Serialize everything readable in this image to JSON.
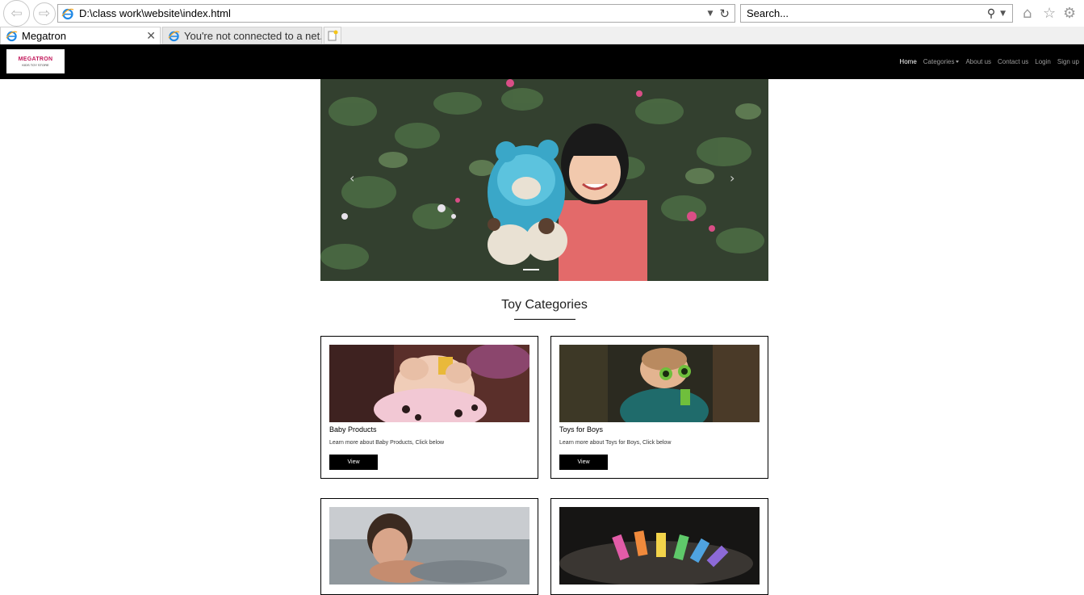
{
  "browser": {
    "url": "D:\\class work\\website\\index.html",
    "search_placeholder": "Search...",
    "tabs": [
      {
        "label": "Megatron"
      },
      {
        "label": "You're not connected to a net..."
      }
    ]
  },
  "site": {
    "logo": {
      "main": "MEGATRON",
      "sub": "KIDS TOY STORE"
    },
    "nav": [
      {
        "label": "Home"
      },
      {
        "label": "Categories"
      },
      {
        "label": "About us"
      },
      {
        "label": "Contact us"
      },
      {
        "label": "Login"
      },
      {
        "label": "Sign up"
      }
    ],
    "section_title": "Toy Categories",
    "cards": [
      {
        "title": "Baby Products",
        "text": "Learn more about Baby Products, Click below",
        "button": "View"
      },
      {
        "title": "Toys for Boys",
        "text": "Learn more about Toys for Boys, Click below",
        "button": "View"
      }
    ]
  }
}
